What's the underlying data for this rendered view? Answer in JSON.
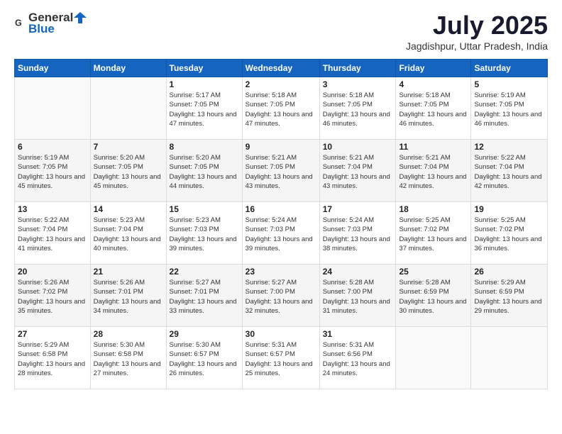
{
  "header": {
    "logo_general": "General",
    "logo_blue": "Blue",
    "month_year": "July 2025",
    "location": "Jagdishpur, Uttar Pradesh, India"
  },
  "weekdays": [
    "Sunday",
    "Monday",
    "Tuesday",
    "Wednesday",
    "Thursday",
    "Friday",
    "Saturday"
  ],
  "weeks": [
    [
      {
        "day": "",
        "sunrise": "",
        "sunset": "",
        "daylight": ""
      },
      {
        "day": "",
        "sunrise": "",
        "sunset": "",
        "daylight": ""
      },
      {
        "day": "1",
        "sunrise": "Sunrise: 5:17 AM",
        "sunset": "Sunset: 7:05 PM",
        "daylight": "Daylight: 13 hours and 47 minutes."
      },
      {
        "day": "2",
        "sunrise": "Sunrise: 5:18 AM",
        "sunset": "Sunset: 7:05 PM",
        "daylight": "Daylight: 13 hours and 47 minutes."
      },
      {
        "day": "3",
        "sunrise": "Sunrise: 5:18 AM",
        "sunset": "Sunset: 7:05 PM",
        "daylight": "Daylight: 13 hours and 46 minutes."
      },
      {
        "day": "4",
        "sunrise": "Sunrise: 5:18 AM",
        "sunset": "Sunset: 7:05 PM",
        "daylight": "Daylight: 13 hours and 46 minutes."
      },
      {
        "day": "5",
        "sunrise": "Sunrise: 5:19 AM",
        "sunset": "Sunset: 7:05 PM",
        "daylight": "Daylight: 13 hours and 46 minutes."
      }
    ],
    [
      {
        "day": "6",
        "sunrise": "Sunrise: 5:19 AM",
        "sunset": "Sunset: 7:05 PM",
        "daylight": "Daylight: 13 hours and 45 minutes."
      },
      {
        "day": "7",
        "sunrise": "Sunrise: 5:20 AM",
        "sunset": "Sunset: 7:05 PM",
        "daylight": "Daylight: 13 hours and 45 minutes."
      },
      {
        "day": "8",
        "sunrise": "Sunrise: 5:20 AM",
        "sunset": "Sunset: 7:05 PM",
        "daylight": "Daylight: 13 hours and 44 minutes."
      },
      {
        "day": "9",
        "sunrise": "Sunrise: 5:21 AM",
        "sunset": "Sunset: 7:05 PM",
        "daylight": "Daylight: 13 hours and 43 minutes."
      },
      {
        "day": "10",
        "sunrise": "Sunrise: 5:21 AM",
        "sunset": "Sunset: 7:04 PM",
        "daylight": "Daylight: 13 hours and 43 minutes."
      },
      {
        "day": "11",
        "sunrise": "Sunrise: 5:21 AM",
        "sunset": "Sunset: 7:04 PM",
        "daylight": "Daylight: 13 hours and 42 minutes."
      },
      {
        "day": "12",
        "sunrise": "Sunrise: 5:22 AM",
        "sunset": "Sunset: 7:04 PM",
        "daylight": "Daylight: 13 hours and 42 minutes."
      }
    ],
    [
      {
        "day": "13",
        "sunrise": "Sunrise: 5:22 AM",
        "sunset": "Sunset: 7:04 PM",
        "daylight": "Daylight: 13 hours and 41 minutes."
      },
      {
        "day": "14",
        "sunrise": "Sunrise: 5:23 AM",
        "sunset": "Sunset: 7:04 PM",
        "daylight": "Daylight: 13 hours and 40 minutes."
      },
      {
        "day": "15",
        "sunrise": "Sunrise: 5:23 AM",
        "sunset": "Sunset: 7:03 PM",
        "daylight": "Daylight: 13 hours and 39 minutes."
      },
      {
        "day": "16",
        "sunrise": "Sunrise: 5:24 AM",
        "sunset": "Sunset: 7:03 PM",
        "daylight": "Daylight: 13 hours and 39 minutes."
      },
      {
        "day": "17",
        "sunrise": "Sunrise: 5:24 AM",
        "sunset": "Sunset: 7:03 PM",
        "daylight": "Daylight: 13 hours and 38 minutes."
      },
      {
        "day": "18",
        "sunrise": "Sunrise: 5:25 AM",
        "sunset": "Sunset: 7:02 PM",
        "daylight": "Daylight: 13 hours and 37 minutes."
      },
      {
        "day": "19",
        "sunrise": "Sunrise: 5:25 AM",
        "sunset": "Sunset: 7:02 PM",
        "daylight": "Daylight: 13 hours and 36 minutes."
      }
    ],
    [
      {
        "day": "20",
        "sunrise": "Sunrise: 5:26 AM",
        "sunset": "Sunset: 7:02 PM",
        "daylight": "Daylight: 13 hours and 35 minutes."
      },
      {
        "day": "21",
        "sunrise": "Sunrise: 5:26 AM",
        "sunset": "Sunset: 7:01 PM",
        "daylight": "Daylight: 13 hours and 34 minutes."
      },
      {
        "day": "22",
        "sunrise": "Sunrise: 5:27 AM",
        "sunset": "Sunset: 7:01 PM",
        "daylight": "Daylight: 13 hours and 33 minutes."
      },
      {
        "day": "23",
        "sunrise": "Sunrise: 5:27 AM",
        "sunset": "Sunset: 7:00 PM",
        "daylight": "Daylight: 13 hours and 32 minutes."
      },
      {
        "day": "24",
        "sunrise": "Sunrise: 5:28 AM",
        "sunset": "Sunset: 7:00 PM",
        "daylight": "Daylight: 13 hours and 31 minutes."
      },
      {
        "day": "25",
        "sunrise": "Sunrise: 5:28 AM",
        "sunset": "Sunset: 6:59 PM",
        "daylight": "Daylight: 13 hours and 30 minutes."
      },
      {
        "day": "26",
        "sunrise": "Sunrise: 5:29 AM",
        "sunset": "Sunset: 6:59 PM",
        "daylight": "Daylight: 13 hours and 29 minutes."
      }
    ],
    [
      {
        "day": "27",
        "sunrise": "Sunrise: 5:29 AM",
        "sunset": "Sunset: 6:58 PM",
        "daylight": "Daylight: 13 hours and 28 minutes."
      },
      {
        "day": "28",
        "sunrise": "Sunrise: 5:30 AM",
        "sunset": "Sunset: 6:58 PM",
        "daylight": "Daylight: 13 hours and 27 minutes."
      },
      {
        "day": "29",
        "sunrise": "Sunrise: 5:30 AM",
        "sunset": "Sunset: 6:57 PM",
        "daylight": "Daylight: 13 hours and 26 minutes."
      },
      {
        "day": "30",
        "sunrise": "Sunrise: 5:31 AM",
        "sunset": "Sunset: 6:57 PM",
        "daylight": "Daylight: 13 hours and 25 minutes."
      },
      {
        "day": "31",
        "sunrise": "Sunrise: 5:31 AM",
        "sunset": "Sunset: 6:56 PM",
        "daylight": "Daylight: 13 hours and 24 minutes."
      },
      {
        "day": "",
        "sunrise": "",
        "sunset": "",
        "daylight": ""
      },
      {
        "day": "",
        "sunrise": "",
        "sunset": "",
        "daylight": ""
      }
    ]
  ]
}
